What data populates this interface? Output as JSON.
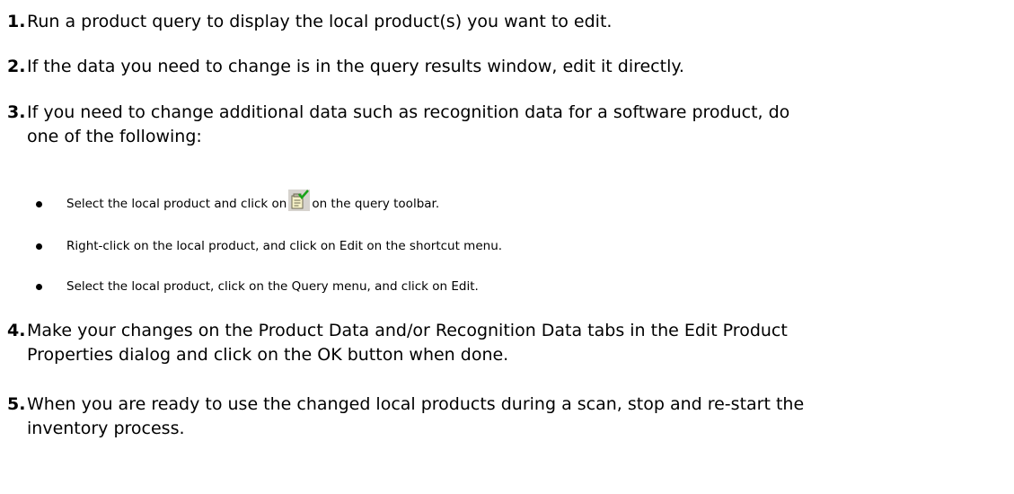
{
  "steps": [
    {
      "number": "1.",
      "text": "Run a product query to display the local product(s) you want to edit."
    },
    {
      "number": "2.",
      "text": "If the data you need to change is in the query results window, edit it directly."
    },
    {
      "number": "3.",
      "text_line1": "If you need to change additional data such as recognition data for a software product, do",
      "text_line2": "one of the following:"
    },
    {
      "number": "4.",
      "text_line1": "Make your changes on the Product Data and/or Recognition Data tabs in the Edit Product",
      "text_line2": "Properties dialog and click on the OK button when done."
    },
    {
      "number": "5.",
      "text_line1": "When you are ready to use the changed local products during a scan, stop and re-start the",
      "text_line2": "inventory process."
    }
  ],
  "bullets": {
    "b1_before": "Select the local product and click on",
    "b1_icon": "edit-properties-icon",
    "b1_after": "on the query toolbar.",
    "b2": "Right-click on the local product, and click on Edit on the shortcut menu.",
    "b3": "Select the local product, click on the Query menu, and click on Edit."
  }
}
